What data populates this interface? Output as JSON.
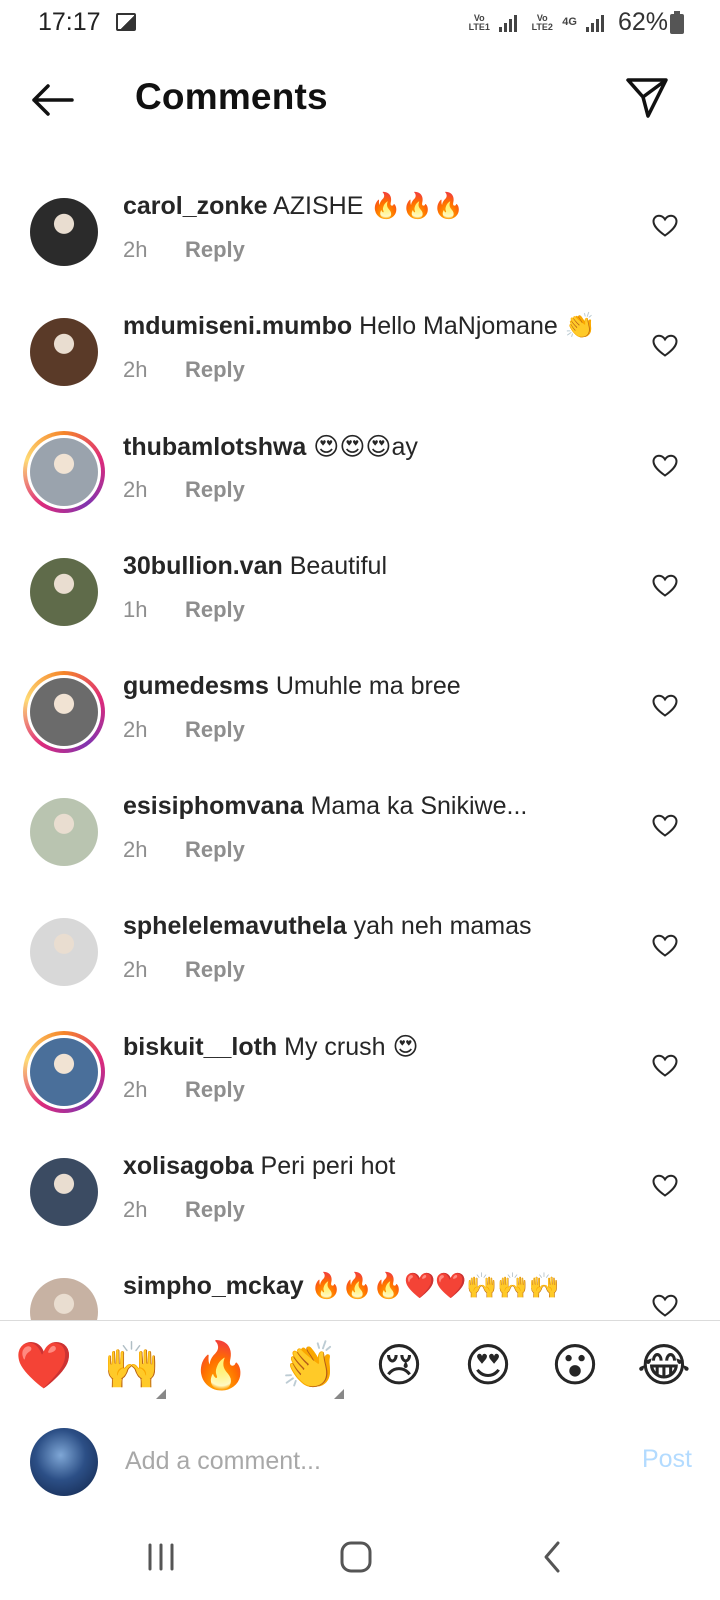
{
  "status_bar": {
    "time": "17:17",
    "sim1_label": "Vo LTE1",
    "sim2_label": "Vo LTE2",
    "network": "4G",
    "battery": "62%",
    "icons": [
      "image-icon",
      "signal-icon",
      "battery-icon"
    ]
  },
  "header": {
    "title": "Comments",
    "back_icon": "arrow-left-icon",
    "share_icon": "paper-plane-icon"
  },
  "comments": [
    {
      "user": "carol_zonke",
      "text": "AZISHE 🔥🔥🔥",
      "time": "2h",
      "reply": "Reply",
      "ring": false,
      "avatar_color": "#2b2b2b"
    },
    {
      "user": "mdumiseni.mumbo",
      "text": "Hello MaNjomane 👏",
      "time": "2h",
      "reply": "Reply",
      "ring": false,
      "avatar_color": "#5a3a28"
    },
    {
      "user": "thubamlotshwa",
      "text": "😍😍😍ay",
      "time": "2h",
      "reply": "Reply",
      "ring": true,
      "avatar_color": "#9aa3ad"
    },
    {
      "user": "30bullion.van",
      "text": "Beautiful",
      "time": "1h",
      "reply": "Reply",
      "ring": false,
      "avatar_color": "#5f6b4a"
    },
    {
      "user": "gumedesms",
      "text": "Umuhle ma bree",
      "time": "2h",
      "reply": "Reply",
      "ring": true,
      "avatar_color": "#6b6b6b"
    },
    {
      "user": "esisiphomvana",
      "text": "Mama ka Snikiwe...",
      "time": "2h",
      "reply": "Reply",
      "ring": false,
      "avatar_color": "#b9c4b0"
    },
    {
      "user": "sphelelemavuthela",
      "text": "yah neh mamas",
      "time": "2h",
      "reply": "Reply",
      "ring": false,
      "avatar_color": "#d8d8d8"
    },
    {
      "user": "biskuit__loth",
      "text": "My crush 😍",
      "time": "2h",
      "reply": "Reply",
      "ring": true,
      "avatar_color": "#4a6f9a"
    },
    {
      "user": "xolisagoba",
      "text": "Peri peri hot",
      "time": "2h",
      "reply": "Reply",
      "ring": false,
      "avatar_color": "#3b4b62"
    },
    {
      "user": "simpho_mckay",
      "text": "🔥🔥🔥❤️❤️🙌🙌🙌",
      "time": "",
      "reply": "",
      "ring": false,
      "avatar_color": "#c7b2a3"
    }
  ],
  "reaction_bar": [
    {
      "emoji": "❤️",
      "name": "heart-emoji",
      "has_variants": false
    },
    {
      "emoji": "🙌",
      "name": "raising-hands-emoji",
      "has_variants": true
    },
    {
      "emoji": "🔥",
      "name": "fire-emoji",
      "has_variants": false
    },
    {
      "emoji": "👏",
      "name": "clapping-hands-emoji",
      "has_variants": true
    },
    {
      "emoji": "😢",
      "name": "crying-face-emoji",
      "has_variants": false
    },
    {
      "emoji": "😍",
      "name": "heart-eyes-emoji",
      "has_variants": false
    },
    {
      "emoji": "😮",
      "name": "surprised-face-emoji",
      "has_variants": false
    },
    {
      "emoji": "😂",
      "name": "tears-of-joy-emoji",
      "has_variants": false
    }
  ],
  "composer": {
    "placeholder": "Add a comment...",
    "post_label": "Post"
  },
  "nav_bar": {
    "icons": [
      "recent-apps-icon",
      "home-icon",
      "back-icon"
    ]
  },
  "colors": {
    "text": "#262626",
    "secondary": "#8e8e8e",
    "post_disabled": "#b3dbff",
    "divider": "#dbdbdb"
  }
}
